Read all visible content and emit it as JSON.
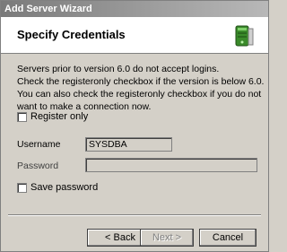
{
  "window": {
    "title": "Add Server Wizard"
  },
  "header": {
    "title": "Specify Credentials",
    "icon": "server-icon"
  },
  "description": {
    "lines": [
      "Servers prior to version 6.0 do not accept logins.",
      "Check the registeronly checkbox if the version is below 6.0.",
      "You can also check the registeronly checkbox if you do not",
      "want to make a connection now."
    ]
  },
  "register_only": {
    "label": "Register only",
    "checked": false
  },
  "username": {
    "label": "Username",
    "value": "SYSDBA"
  },
  "password": {
    "label": "Password",
    "value": ""
  },
  "save_password": {
    "label": "Save password",
    "checked": false
  },
  "buttons": {
    "back": "< Back",
    "next": "Next >",
    "cancel": "Cancel"
  }
}
